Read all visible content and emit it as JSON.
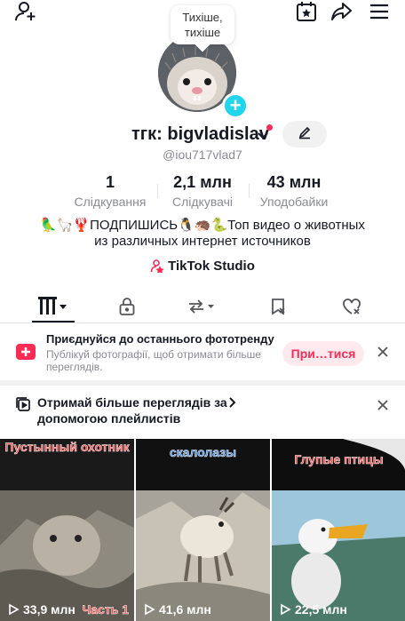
{
  "header": {
    "add_user_icon": "add-user-icon",
    "calendar_icon": "calendar-star-icon",
    "share_icon": "share-arrow-icon",
    "menu_icon": "hamburger-menu-icon"
  },
  "profile": {
    "bubble_text": "Тихіше, тихіше",
    "username": "тгк: bigvladislav",
    "handle": "@iou717vlad7",
    "stats": [
      {
        "value": "1",
        "label": "Слідкування"
      },
      {
        "value": "2,1 млн",
        "label": "Слідкувачі"
      },
      {
        "value": "43 млн",
        "label": "Уподобайки"
      }
    ],
    "bio_line1": "🦜🦙🦞ПОДПИШИСЬ🐧🦔🐍Топ видео о животных",
    "bio_line2": "из различных интернет источников",
    "studio_label": "TikTok Studio"
  },
  "tabs": [
    "videos-grid",
    "private",
    "reposts",
    "favorites",
    "liked"
  ],
  "banner_photo_trend": {
    "title": "Приєднуйся до останнього фототренду",
    "subtitle": "Публікуй фотографії, щоб отримати більше переглядів.",
    "button": "При…тися"
  },
  "banner_playlists": {
    "text": "Отримай більше переглядів за допомогою плейлистів"
  },
  "videos": [
    {
      "caption": "Пустынный охотник",
      "views": "33,9 млн",
      "part": "Часть 1"
    },
    {
      "caption": "скалолазы",
      "views": "41,6 млн",
      "part": ""
    },
    {
      "caption": "Глупые птицы",
      "views": "22,5 млн",
      "part": ""
    }
  ],
  "colors": {
    "accent": "#fe2c55",
    "badge": "#20d5ec",
    "text": "#161823",
    "muted": "#8a8b91"
  }
}
